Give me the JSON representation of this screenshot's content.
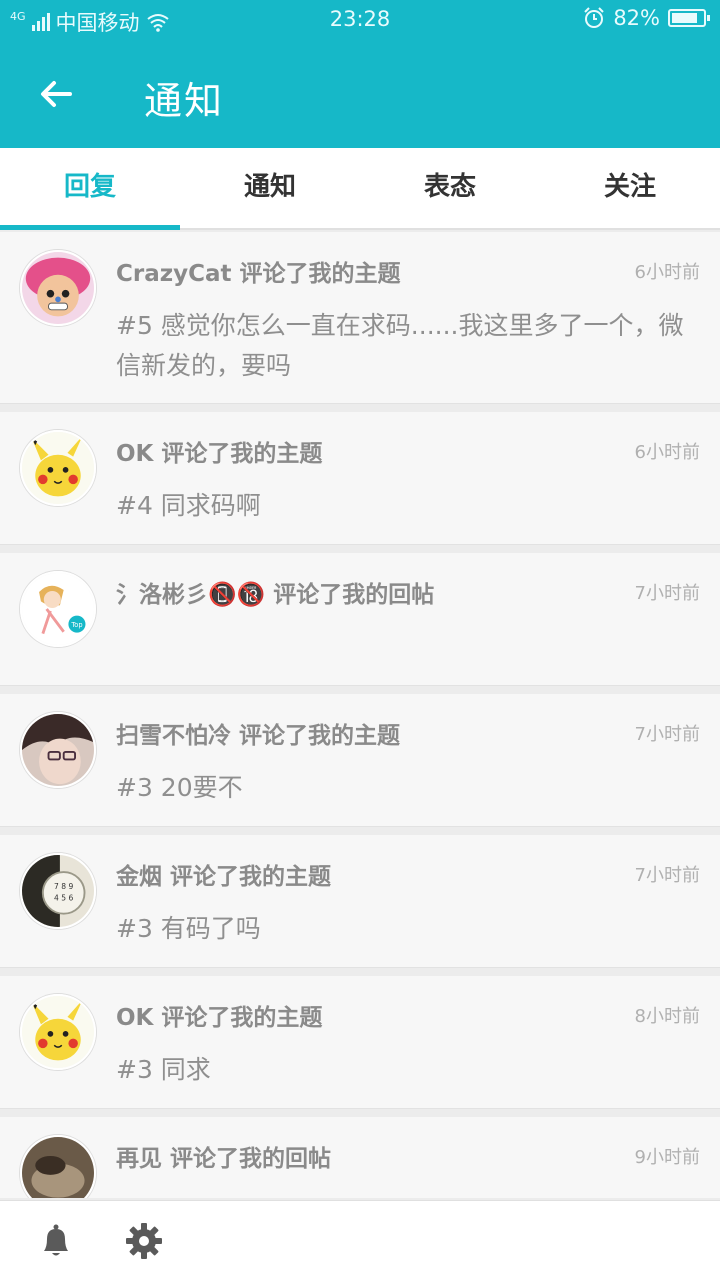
{
  "status_bar": {
    "network": "4G",
    "carrier": "中国移动",
    "time": "23:28",
    "battery": "82%",
    "battery_level": 0.82
  },
  "header": {
    "title": "通知"
  },
  "tabs": [
    {
      "label": "回复",
      "active": true
    },
    {
      "label": "通知",
      "active": false
    },
    {
      "label": "表态",
      "active": false
    },
    {
      "label": "关注",
      "active": false
    }
  ],
  "notifications": [
    {
      "title": "CrazyCat 评论了我的主题",
      "time": "6小时前",
      "body": "#5 感觉你怎么一直在求码......我这里多了一个，微信新发的，要吗",
      "avatar": "chopper-avatar"
    },
    {
      "title": "OK 评论了我的主题",
      "time": "6小时前",
      "body": "#4 同求码啊",
      "avatar": "pikachu-avatar"
    },
    {
      "title": "氵洛彬彡📵🔞 评论了我的回帖",
      "time": "7小时前",
      "body": "",
      "avatar": "anime-girl-avatar"
    },
    {
      "title": "扫雪不怕冷 评论了我的主题",
      "time": "7小时前",
      "body": "#3 20要不",
      "avatar": "glasses-boy-avatar"
    },
    {
      "title": "金烟 评论了我的主题",
      "time": "7小时前",
      "body": "#3 有码了吗",
      "avatar": "phone-avatar"
    },
    {
      "title": "OK 评论了我的主题",
      "time": "8小时前",
      "body": "#3 同求",
      "avatar": "pikachu-avatar"
    },
    {
      "title": "再见 评论了我的回帖",
      "time": "9小时前",
      "body": "",
      "avatar": "photo-avatar"
    }
  ],
  "footer": {
    "icons": [
      "bell-icon",
      "gear-icon"
    ]
  },
  "colors": {
    "accent": "#16b8c8",
    "text_gray": "#8a8a8a"
  }
}
